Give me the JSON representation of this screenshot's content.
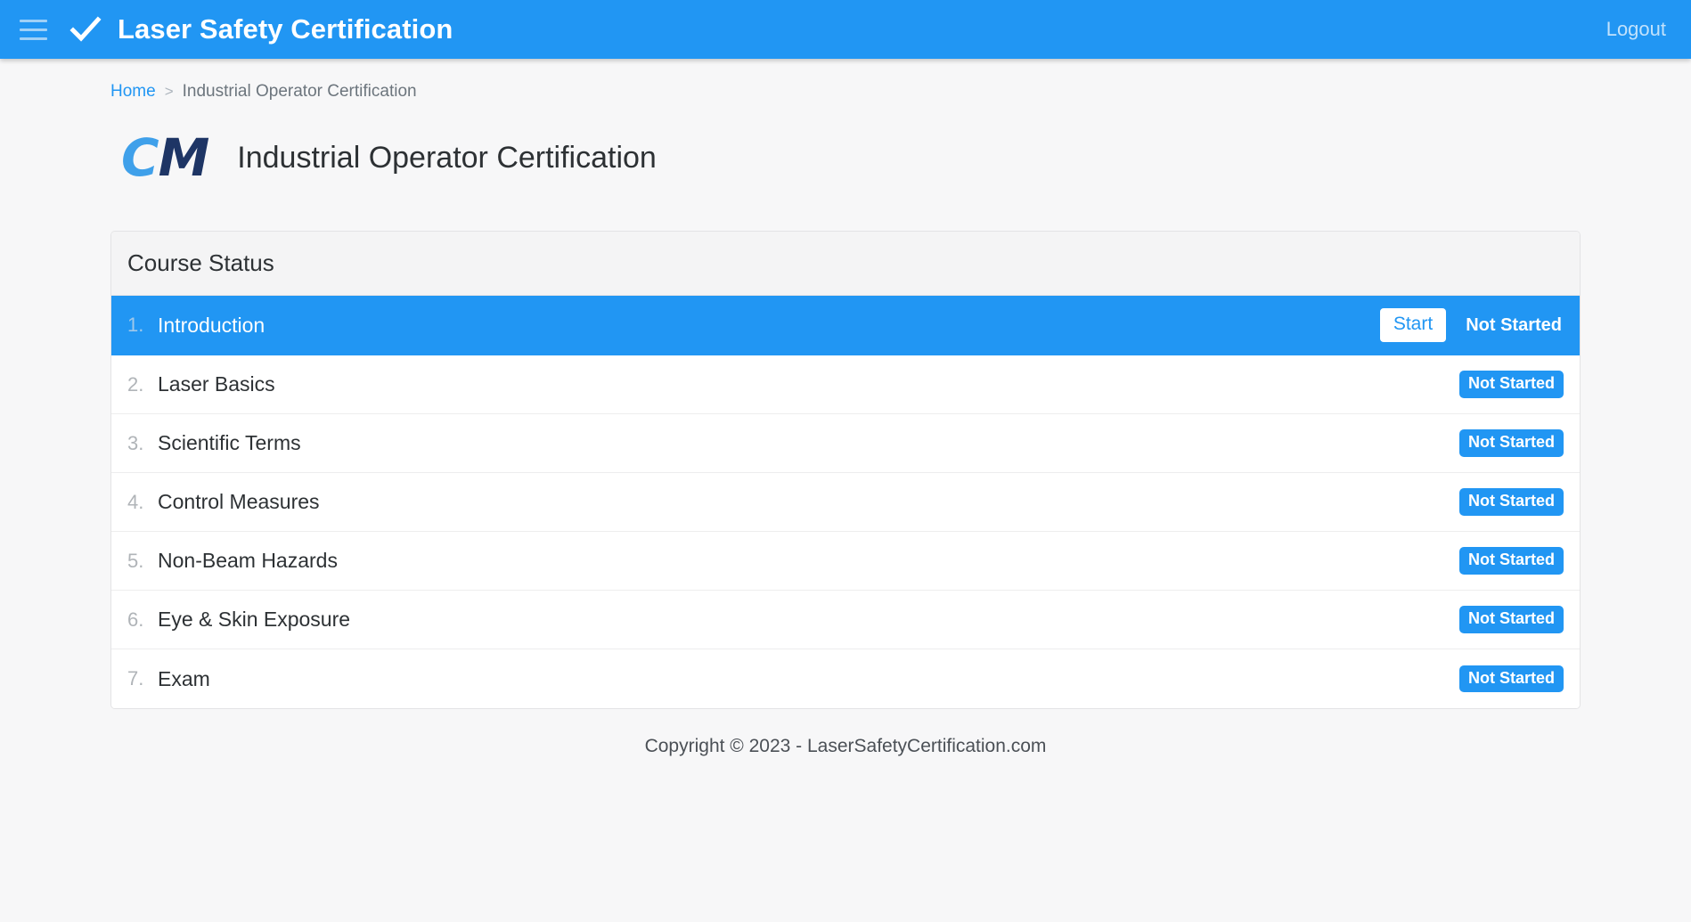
{
  "header": {
    "menu_icon": "hamburger-menu-icon",
    "logo_icon": "checkmark-icon",
    "title": "Laser Safety Certification",
    "logout_label": "Logout",
    "background_color": "#2196f3"
  },
  "breadcrumb": {
    "home_label": "Home",
    "separator": ">",
    "current_label": "Industrial Operator Certification",
    "link_color": "#2196f3"
  },
  "page": {
    "logo_c": "C",
    "logo_m": "M",
    "logo_c_color": "#3fa0ea",
    "logo_m_color": "#1e3565",
    "title": "Industrial Operator Certification"
  },
  "course_card": {
    "header_label": "Course Status",
    "rows": [
      {
        "num": "1.",
        "title": "Introduction",
        "status": "Not Started",
        "action_label": "Start",
        "active": true
      },
      {
        "num": "2.",
        "title": "Laser Basics",
        "status": "Not Started",
        "action_label": "",
        "active": false
      },
      {
        "num": "3.",
        "title": "Scientific Terms",
        "status": "Not Started",
        "action_label": "",
        "active": false
      },
      {
        "num": "4.",
        "title": "Control Measures",
        "status": "Not Started",
        "action_label": "",
        "active": false
      },
      {
        "num": "5.",
        "title": "Non-Beam Hazards",
        "status": "Not Started",
        "action_label": "",
        "active": false
      },
      {
        "num": "6.",
        "title": "Eye & Skin Exposure",
        "status": "Not Started",
        "action_label": "",
        "active": false
      },
      {
        "num": "7.",
        "title": "Exam",
        "status": "Not Started",
        "action_label": "",
        "active": false
      }
    ]
  },
  "footer": {
    "copyright": "Copyright © 2023 - LaserSafetyCertification.com"
  }
}
